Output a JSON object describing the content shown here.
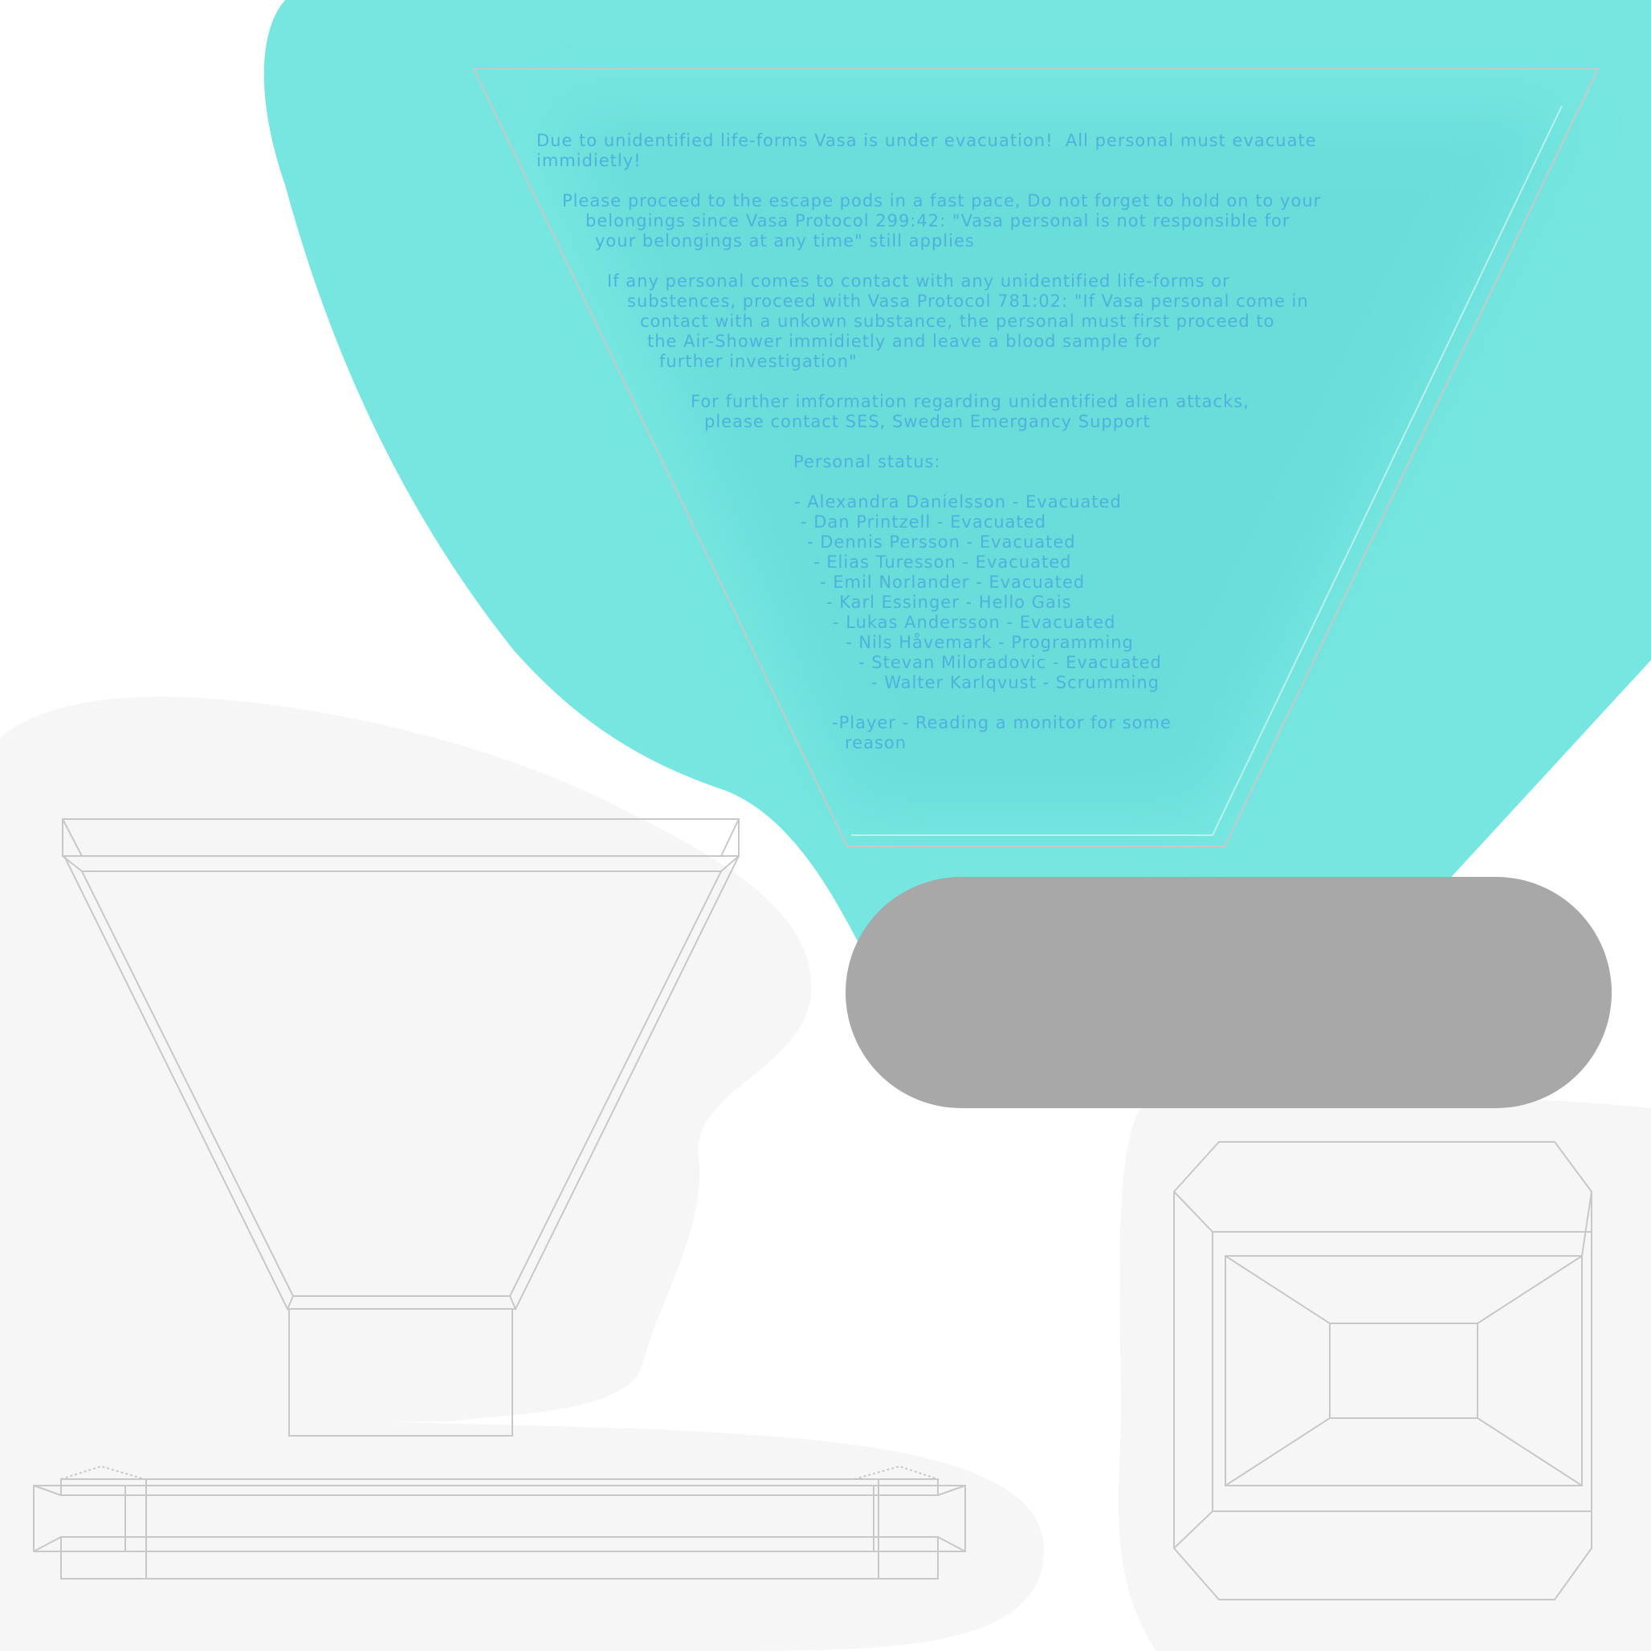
{
  "colors": {
    "screen_glow": "#77e6e0",
    "screen_inner": "#5fd7d4",
    "text": "#4fb2dd",
    "pill": "#a8a8a8",
    "wire": "#c8c8c8",
    "shadow": "#f6f6f6"
  },
  "monitor": {
    "lines": [
      "Due to unidentified life-forms Vasa is under evacuation!  All personal must evacuate",
      "immidietly!",
      "Please proceed to the escape pods in a fast pace, Do not forget to hold on to your",
      "belongings since Vasa Protocol 299:42: \"Vasa personal is not responsible for",
      "your belongings at any time\" still applies",
      "If any personal comes to contact with any unidentified life-forms or",
      "substences, proceed with Vasa Protocol 781:02: \"If Vasa personal come in",
      "contact with a unkown substance, the personal must first proceed to",
      "the Air-Shower immidietly and leave a blood sample for",
      "further investigation\"",
      "For further imformation regarding unidentified alien attacks,",
      "please contact SES, Sweden Emergancy Support",
      "Personal status:",
      "- Alexandra Danielsson - Evacuated",
      "- Dan Printzell - Evacuated",
      "- Dennis Persson - Evacuated",
      "- Elias Turesson - Evacuated",
      "- Emil Norlander - Evacuated",
      "- Karl Essinger - Hello Gais",
      "- Lukas Andersson - Evacuated",
      "- Nils Håvemark - Programming",
      "- Stevan Miloradovic - Evacuated",
      "- Walter Karlqvust - Scrumming",
      "-Player - Reading a monitor for some",
      "reason"
    ]
  }
}
